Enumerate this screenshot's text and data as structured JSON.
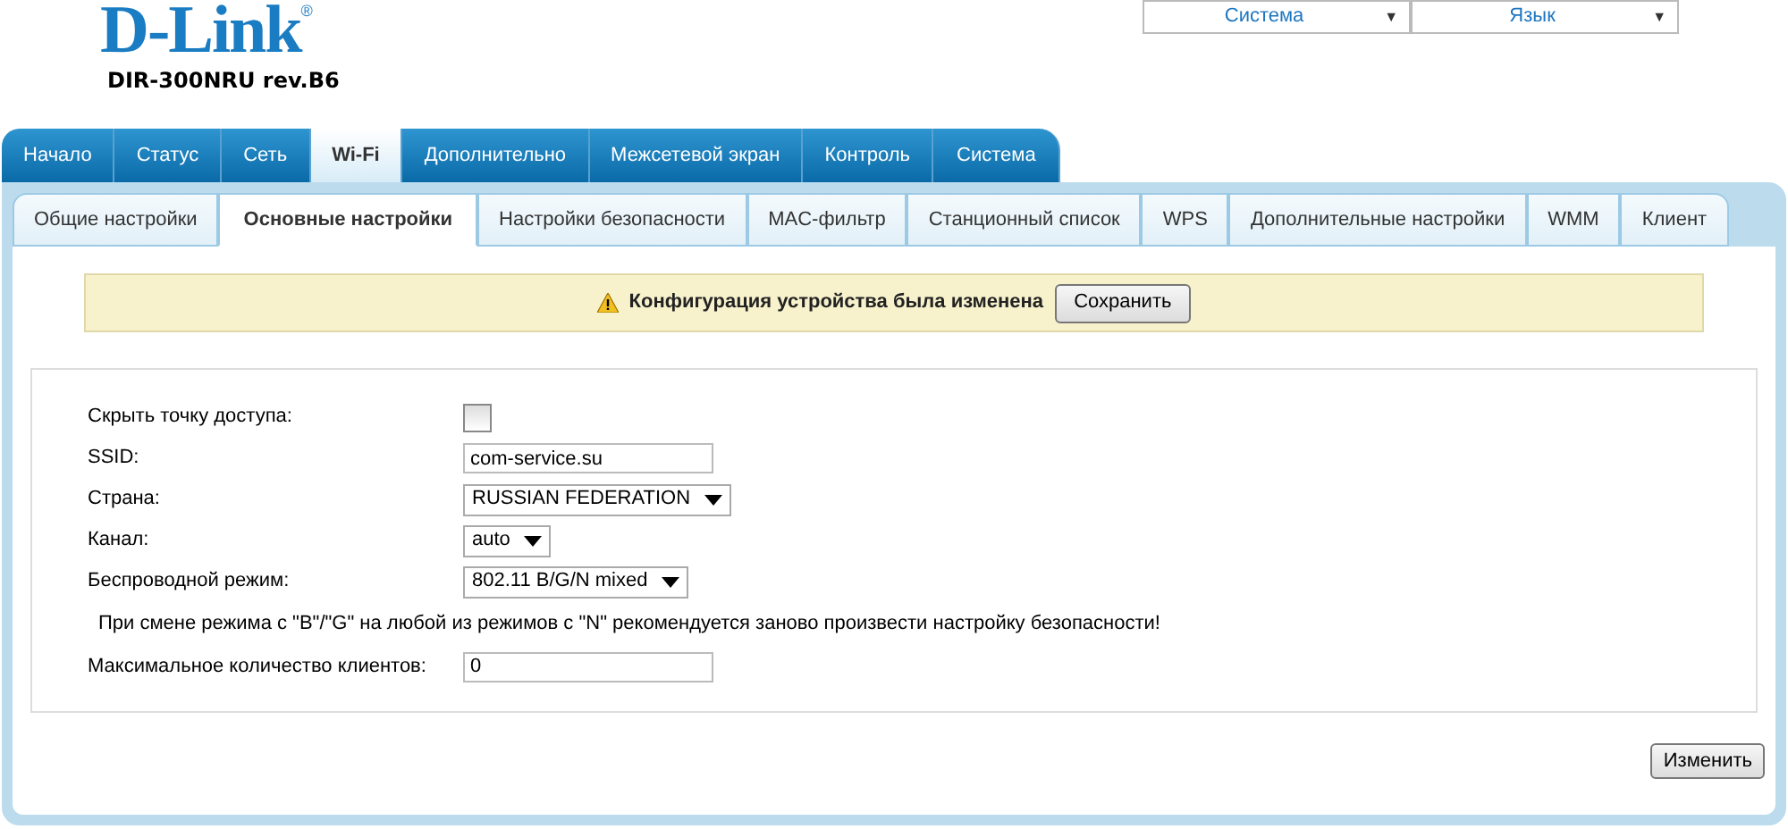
{
  "logo": {
    "brand": "D-Link",
    "registered": "®",
    "model": "DIR-300NRU rev.B6"
  },
  "top_menus": [
    {
      "label": "Система",
      "arrow": "▼"
    },
    {
      "label": "Язык",
      "arrow": "▼"
    }
  ],
  "tabs": [
    {
      "label": "Начало",
      "selected": false
    },
    {
      "label": "Статус",
      "selected": false
    },
    {
      "label": "Сеть",
      "selected": false
    },
    {
      "label": "Wi-Fi",
      "selected": true
    },
    {
      "label": "Дополнительно",
      "selected": false
    },
    {
      "label": "Межсетевой экран",
      "selected": false
    },
    {
      "label": "Контроль",
      "selected": false
    },
    {
      "label": "Система",
      "selected": false
    }
  ],
  "subtabs": [
    {
      "label": "Общие настройки",
      "selected": false
    },
    {
      "label": "Основные настройки",
      "selected": true
    },
    {
      "label": "Настройки безопасности",
      "selected": false
    },
    {
      "label": "MAC-фильтр",
      "selected": false
    },
    {
      "label": "Станционный список",
      "selected": false
    },
    {
      "label": "WPS",
      "selected": false
    },
    {
      "label": "Дополнительные настройки",
      "selected": false
    },
    {
      "label": "WMM",
      "selected": false
    },
    {
      "label": "Клиент",
      "selected": false
    }
  ],
  "notice": {
    "text": "Конфигурация устройства была изменена",
    "button": "Сохранить"
  },
  "form": [
    {
      "kind": "checkbox",
      "label": "Скрыть точку доступа:",
      "checked": false
    },
    {
      "kind": "text",
      "label": "SSID:",
      "value": "com-service.su"
    },
    {
      "kind": "select",
      "label": "Страна:",
      "value": "RUSSIAN FEDERATION"
    },
    {
      "kind": "select",
      "label": "Канал:",
      "value": "auto"
    },
    {
      "kind": "select",
      "label": "Беспроводной режим:",
      "value": "802.11 B/G/N mixed"
    },
    {
      "kind": "note",
      "text": "При смене режима с \"B\"/\"G\" на любой из режимов с \"N\" рекомендуется заново произвести настройку безопасности!"
    },
    {
      "kind": "text",
      "label": "Максимальное количество клиентов:",
      "value": "0"
    }
  ],
  "apply_button": "Изменить"
}
